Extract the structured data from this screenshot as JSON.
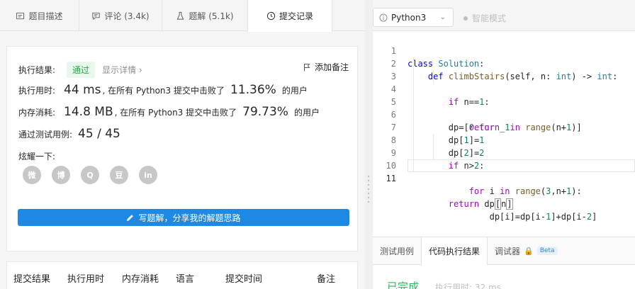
{
  "left_tabs": [
    {
      "label": "题目描述",
      "icon": "description-icon"
    },
    {
      "label": "评论 (3.4k)",
      "icon": "comment-icon"
    },
    {
      "label": "题解 (5.1k)",
      "icon": "flask-icon"
    },
    {
      "label": "提交记录",
      "icon": "clock-icon"
    }
  ],
  "result": {
    "status_label": "执行结果:",
    "status_value": "通过",
    "detail_link": "显示详情 ›",
    "add_note": "添加备注",
    "time_label": "执行用时:",
    "time_value": "44 ms",
    "time_text": ", 在所有 Python3 提交中击败了",
    "time_percent": "11.36%",
    "time_suffix": "的用户",
    "mem_label": "内存消耗:",
    "mem_value": "14.8 MB",
    "mem_text": ", 在所有 Python3 提交中击败了",
    "mem_percent": "79.73%",
    "mem_suffix": "的用户",
    "cases_label": "通过测试用例:",
    "cases_value": "45 / 45",
    "share_label": "炫耀一下:",
    "share_icons": [
      "wechat-icon",
      "weibo-icon",
      "qq-icon",
      "douban-icon",
      "linkedin-icon"
    ],
    "share_glyphs": [
      "微",
      "博",
      "Q",
      "豆",
      "in"
    ],
    "write_button": "写题解，分享我的解题思路"
  },
  "table_headers": [
    "提交结果",
    "执行用时",
    "内存消耗",
    "语言",
    "提交时间",
    "备注"
  ],
  "editor": {
    "language": "Python3",
    "smart_mode": "智能模式",
    "lines": [
      "class Solution:",
      "    def climbStairs(self, n: int) -> int:",
      "        if n==1:",
      "            return 1",
      "        dp=[0 for _ in range(n+1)]",
      "        dp[1]=1",
      "        dp[2]=2",
      "        if n>2:",
      "            for i in range(3,n+1):",
      "                dp[i]=dp[i-1]+dp[i-2]",
      "        return dp[n]"
    ],
    "line_numbers": [
      "1",
      "2",
      "3",
      "4",
      "5",
      "6",
      "7",
      "8",
      "9",
      "10",
      "11"
    ]
  },
  "bottom_tabs": [
    "测试用例",
    "代码执行结果",
    "调试器"
  ],
  "beta_label": "Beta",
  "run_status": "已完成",
  "run_time": "执行用时: 32 ms",
  "colors": {
    "accent": "#1e88e5",
    "pass_green": "#26a445",
    "done_green": "#2db55d"
  }
}
